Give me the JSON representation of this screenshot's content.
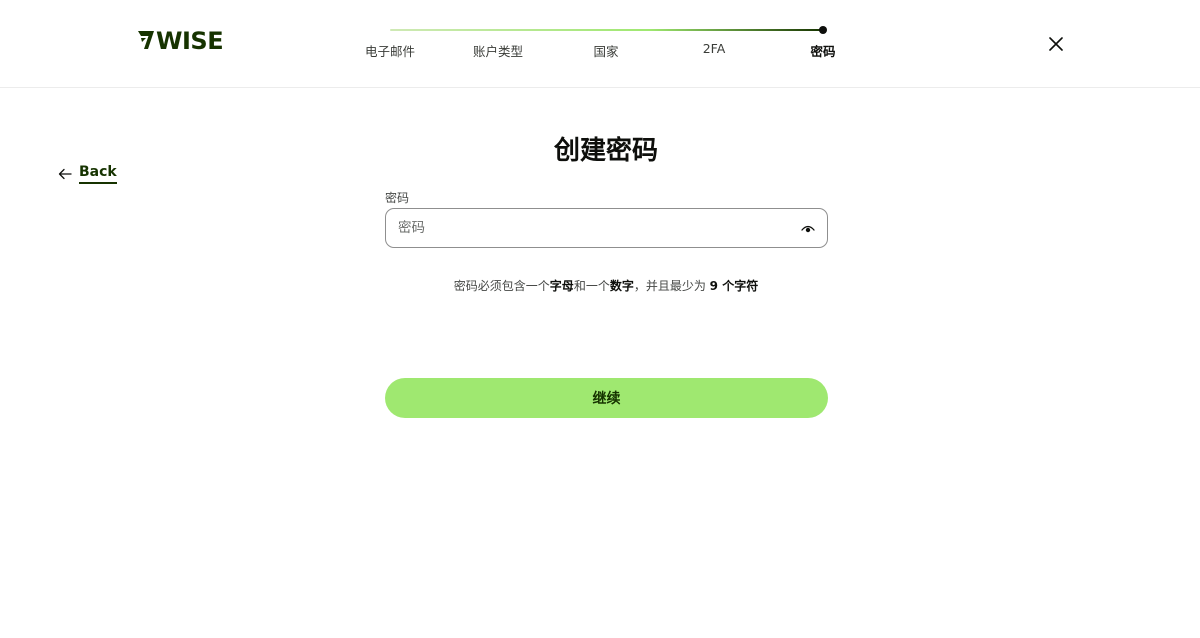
{
  "brand": {
    "logo_text": "WISE",
    "accent": "#9fe870",
    "dark": "#163300"
  },
  "stepper": {
    "steps": [
      {
        "label": "电子邮件"
      },
      {
        "label": "账户类型"
      },
      {
        "label": "国家"
      },
      {
        "label": "2FA"
      },
      {
        "label": "密码",
        "active": true
      }
    ],
    "progress": 1.0
  },
  "header": {
    "close_icon": "close-icon"
  },
  "nav": {
    "back_label": "Back",
    "back_icon": "arrow-left-icon"
  },
  "main": {
    "title": "创建密码",
    "password_label": "密码",
    "password_placeholder": "密码",
    "password_value": "",
    "eye_icon": "eye-icon",
    "hint": {
      "p1": "密码必须包含一个",
      "b1": "字母",
      "p2": "和一个",
      "b2": "数字",
      "p3": "，并且最少为 ",
      "b3": "9 个字符"
    },
    "continue_label": "继续"
  }
}
